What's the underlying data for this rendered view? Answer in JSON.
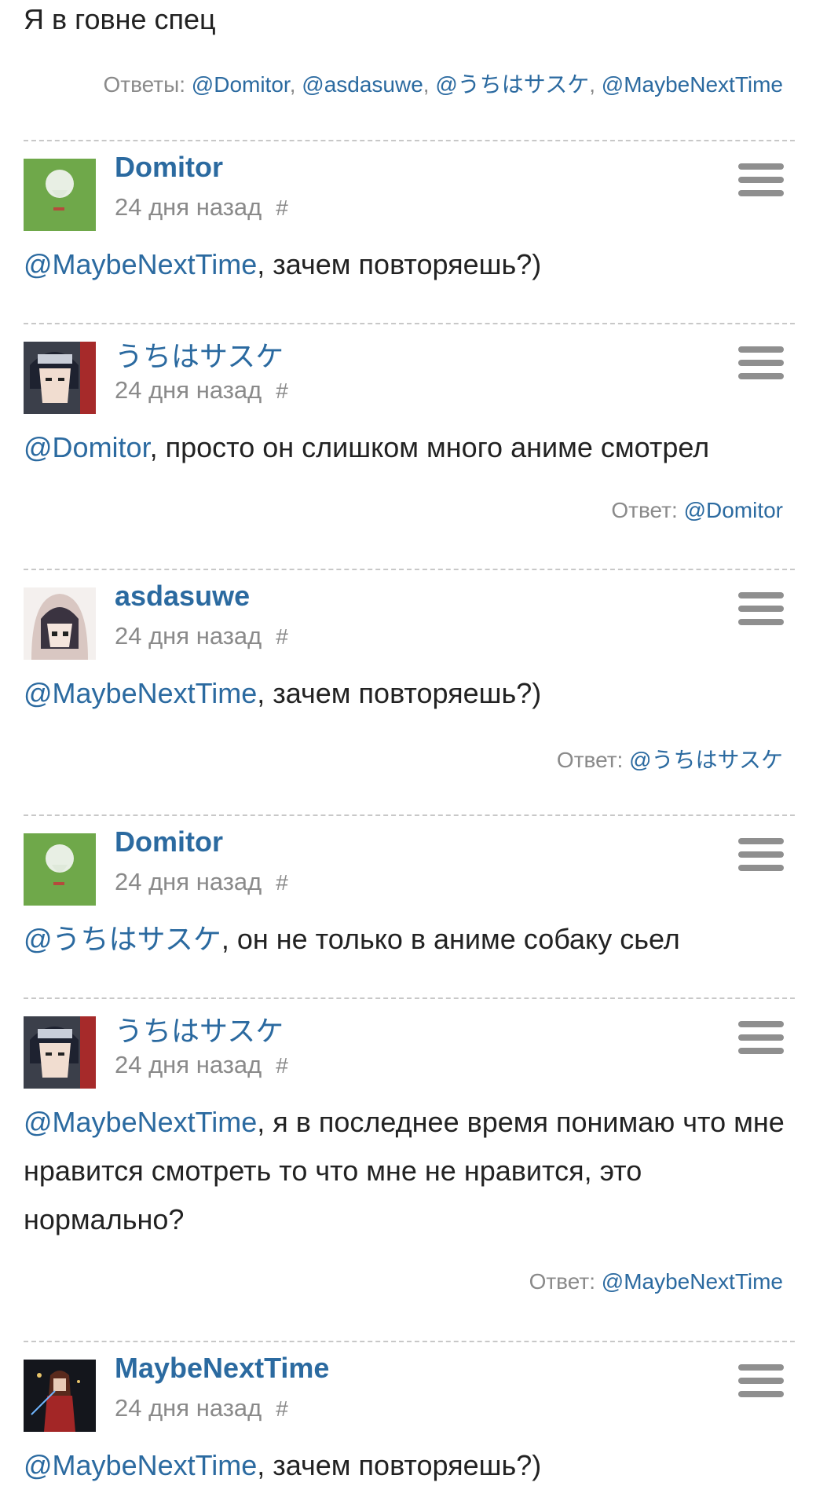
{
  "top_text": "Я в говне спец",
  "top_replies": {
    "prefix": "Ответы:",
    "links": [
      "@Domitor",
      "@asdasuwe",
      "@うちはサスケ",
      "@MaybeNextTime"
    ],
    "separator": ", "
  },
  "hash_symbol": "#",
  "comments": [
    {
      "author": "Domitor",
      "time": "24 дня назад",
      "mention": "@MaybeNextTime",
      "text": ", зачем повторяешь?)",
      "reply_label": "",
      "reply_link": ""
    },
    {
      "author": "うちはサスケ",
      "time": "24 дня назад",
      "mention": "@Domitor",
      "text": ", просто он слишком много аниме смотрел",
      "reply_label": "Ответ:",
      "reply_link": "@Domitor"
    },
    {
      "author": "asdasuwe",
      "time": "24 дня назад",
      "mention": "@MaybeNextTime",
      "text": ", зачем повторяешь?)",
      "reply_label": "Ответ:",
      "reply_link": "@うちはサスケ"
    },
    {
      "author": "Domitor",
      "time": "24 дня назад",
      "mention": "@うちはサスケ",
      "text": ", он не только в аниме собаку сьел",
      "reply_label": "",
      "reply_link": ""
    },
    {
      "author": "うちはサスケ",
      "time": "24 дня назад",
      "mention": "@MaybeNextTime",
      "text": ", я в последнее время понимаю что мне нравится смотреть то что мне не нравится, это нормально?",
      "reply_label": "Ответ:",
      "reply_link": "@MaybeNextTime"
    },
    {
      "author": "MaybeNextTime",
      "time": "24 дня назад",
      "mention": "@MaybeNextTime",
      "text": ", зачем повторяешь?)",
      "reply_label": "",
      "reply_link": ""
    }
  ],
  "colors": {
    "link": "#2b6aa0",
    "muted": "#8a8a8a",
    "divider": "#c8c8c8"
  }
}
